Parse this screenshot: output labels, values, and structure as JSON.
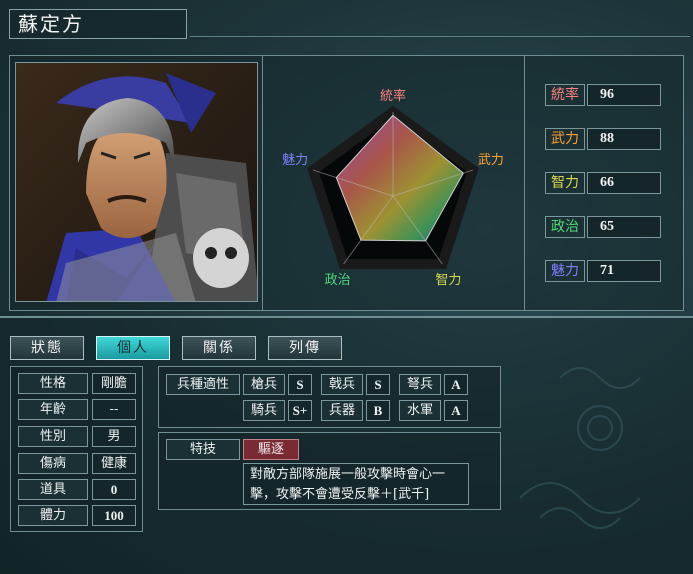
{
  "general": {
    "name": "蘇定方"
  },
  "radar": {
    "labels": {
      "leadership": "統率",
      "war": "武力",
      "intel": "智力",
      "politics": "政治",
      "charm": "魅力"
    },
    "label_colors": {
      "leadership": "#ff8080",
      "war": "#ffa030",
      "intel": "#d8d850",
      "politics": "#50d878",
      "charm": "#8080ff"
    },
    "values": {
      "leadership": 96,
      "war": 88,
      "intel": 66,
      "politics": 65,
      "charm": 71
    }
  },
  "stats": [
    {
      "label": "統率",
      "value": "96",
      "color": "#ff8080"
    },
    {
      "label": "武力",
      "value": "88",
      "color": "#ffa030"
    },
    {
      "label": "智力",
      "value": "66",
      "color": "#d8d850"
    },
    {
      "label": "政治",
      "value": "65",
      "color": "#50d878"
    },
    {
      "label": "魅力",
      "value": "71",
      "color": "#8080ff"
    }
  ],
  "tabs": [
    {
      "label": "狀態",
      "active": false
    },
    {
      "label": "個人",
      "active": true
    },
    {
      "label": "關係",
      "active": false
    },
    {
      "label": "列傳",
      "active": false
    }
  ],
  "personal": [
    {
      "label": "性格",
      "value": "剛膽"
    },
    {
      "label": "年齡",
      "value": "--"
    },
    {
      "label": "性別",
      "value": "男"
    },
    {
      "label": "傷病",
      "value": "健康"
    },
    {
      "label": "道具",
      "value": "0"
    },
    {
      "label": "體力",
      "value": "100"
    }
  ],
  "aptitude": {
    "title": "兵種適性",
    "items": [
      {
        "label": "槍兵",
        "grade": "S"
      },
      {
        "label": "戟兵",
        "grade": "S"
      },
      {
        "label": "弩兵",
        "grade": "A"
      },
      {
        "label": "騎兵",
        "grade": "S+"
      },
      {
        "label": "兵器",
        "grade": "B"
      },
      {
        "label": "水軍",
        "grade": "A"
      }
    ]
  },
  "skill": {
    "title": "特技",
    "name": "驅逐",
    "description_line1": "對敵方部隊施展一般攻擊時會心一",
    "description_line2": "擊，攻擊不會遭受反擊＋[武千]"
  },
  "portrait": {
    "icon": "general-portrait"
  }
}
